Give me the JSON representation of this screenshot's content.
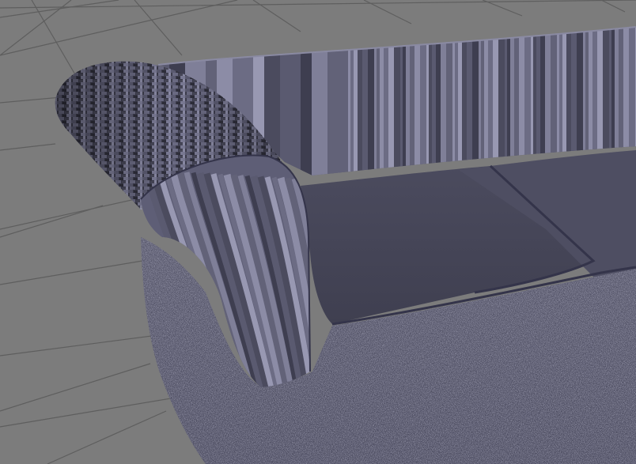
{
  "scene": {
    "background_color": "#7c7c7c",
    "grid_line_color": "#5e5e5e",
    "fabric_base_color": "#4a4a5e",
    "fabric_speck_color": "#8a8aa0",
    "stripe_colors": [
      "#5a5a70",
      "#6c6c84",
      "#7f7f98",
      "#4b4b5e",
      "#8c8ca6",
      "#3e3e50",
      "#9898b2",
      "#626278"
    ],
    "arm_pattern_colors": [
      "#3a3a4a",
      "#55556a",
      "#6e6e86",
      "#8585a0",
      "#2e2e3a"
    ]
  }
}
